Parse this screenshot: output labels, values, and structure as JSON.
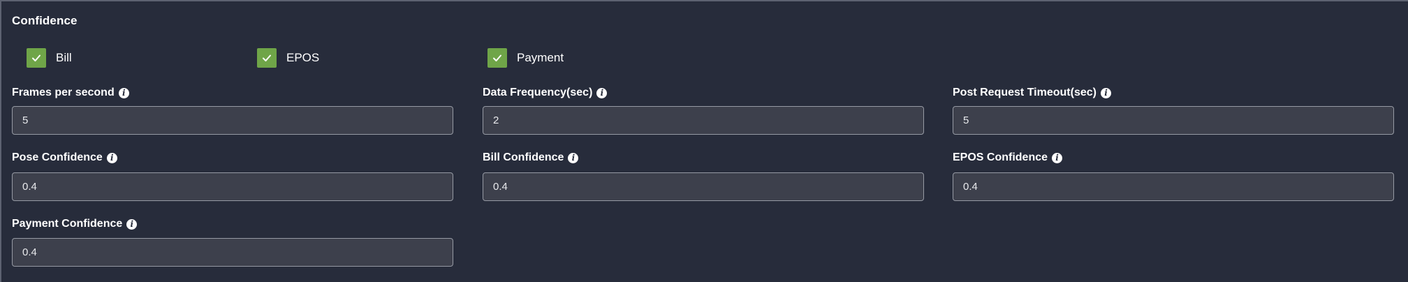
{
  "section": {
    "title": "Confidence"
  },
  "checkboxes": [
    {
      "label": "Bill",
      "checked": true
    },
    {
      "label": "EPOS",
      "checked": true
    },
    {
      "label": "Payment",
      "checked": true
    }
  ],
  "fields": [
    {
      "label": "Frames per second",
      "value": "5"
    },
    {
      "label": "Data Frequency(sec)",
      "value": "2"
    },
    {
      "label": "Post Request Timeout(sec)",
      "value": "5"
    },
    {
      "label": "Pose Confidence",
      "value": "0.4"
    },
    {
      "label": "Bill Confidence",
      "value": "0.4"
    },
    {
      "label": "EPOS Confidence",
      "value": "0.4"
    },
    {
      "label": "Payment Confidence",
      "value": "0.4"
    }
  ],
  "icons": {
    "info": "info-icon",
    "check": "checkmark-icon"
  },
  "colors": {
    "background": "#272c3b",
    "checkbox": "#6fa548",
    "input_bg": "#3d404c",
    "input_border": "#969aa4"
  }
}
